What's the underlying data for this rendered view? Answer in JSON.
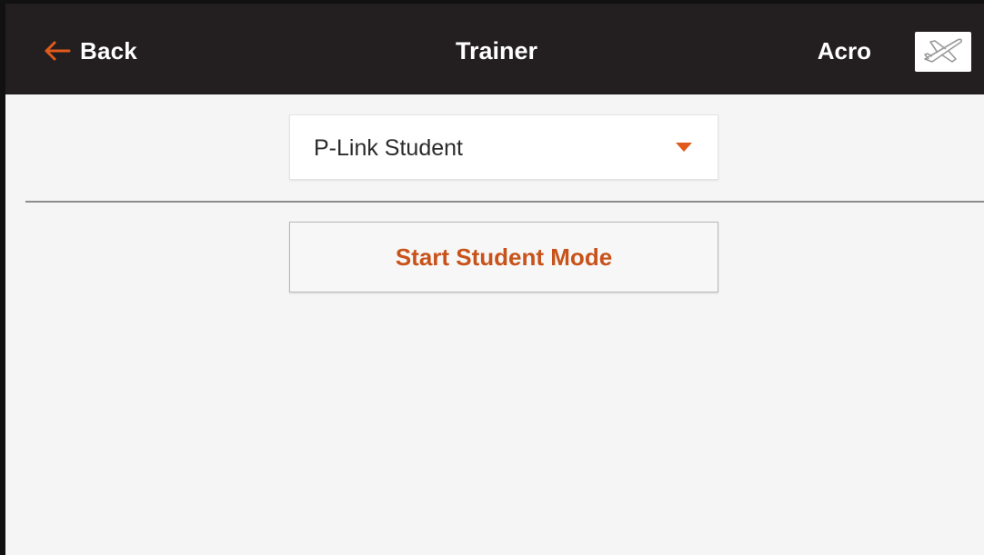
{
  "header": {
    "back_label": "Back",
    "title": "Trainer",
    "model_name": "Acro",
    "back_icon": "arrow-left-icon",
    "model_icon": "airplane-icon"
  },
  "trainer": {
    "mode_select": {
      "selected": "P-Link Student"
    },
    "action_button_label": "Start Student Mode"
  },
  "colors": {
    "accent": "#e05a1c",
    "header_bg": "#231f20",
    "page_bg": "#f5f5f5"
  }
}
